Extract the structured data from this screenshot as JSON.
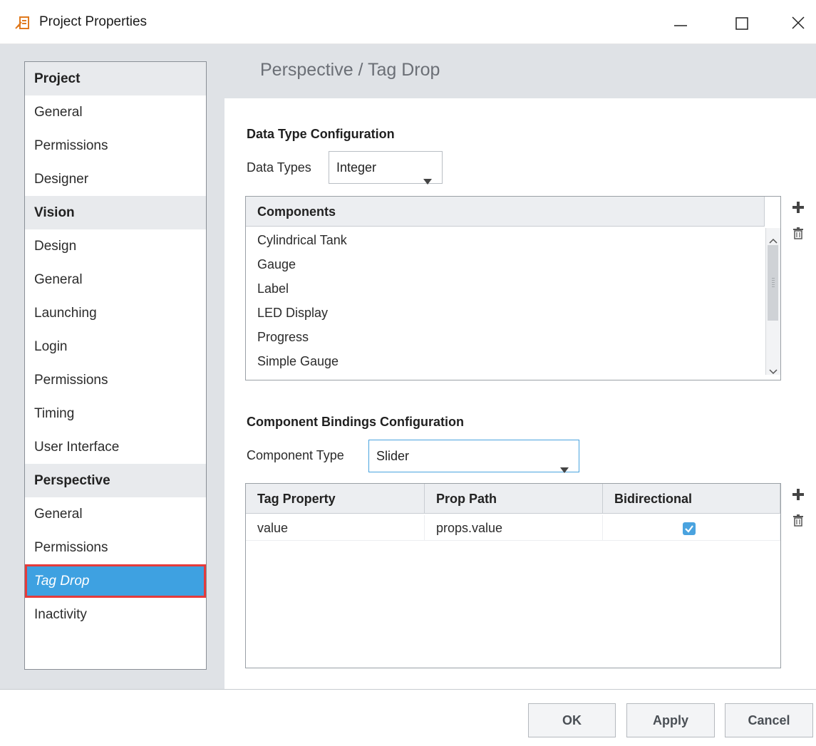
{
  "window": {
    "title": "Project Properties",
    "icons": {
      "app": "project-properties-icon",
      "minimize": "minimize-icon",
      "maximize": "maximize-icon",
      "close": "close-icon"
    }
  },
  "sidebar": {
    "items": [
      {
        "label": "Project",
        "type": "header"
      },
      {
        "label": "General",
        "type": "item"
      },
      {
        "label": "Permissions",
        "type": "item"
      },
      {
        "label": "Designer",
        "type": "item"
      },
      {
        "label": "Vision",
        "type": "header"
      },
      {
        "label": "Design",
        "type": "item"
      },
      {
        "label": "General",
        "type": "item"
      },
      {
        "label": "Launching",
        "type": "item"
      },
      {
        "label": "Login",
        "type": "item"
      },
      {
        "label": "Permissions",
        "type": "item"
      },
      {
        "label": "Timing",
        "type": "item"
      },
      {
        "label": "User Interface",
        "type": "item"
      },
      {
        "label": "Perspective",
        "type": "header"
      },
      {
        "label": "General",
        "type": "item"
      },
      {
        "label": "Permissions",
        "type": "item"
      },
      {
        "label": "Tag Drop",
        "type": "item",
        "selected": true
      },
      {
        "label": "Inactivity",
        "type": "item"
      }
    ]
  },
  "content": {
    "title": "Perspective / Tag Drop",
    "data_type_section": {
      "heading": "Data Type Configuration",
      "data_types_label": "Data Types",
      "data_types_value": "Integer",
      "components_header": "Components",
      "components": [
        "Cylindrical Tank",
        "Gauge",
        "Label",
        "LED Display",
        "Progress",
        "Simple Gauge"
      ]
    },
    "bindings_section": {
      "heading": "Component Bindings Configuration",
      "component_type_label": "Component Type",
      "component_type_value": "Slider",
      "columns": [
        "Tag Property",
        "Prop Path",
        "Bidirectional"
      ],
      "rows": [
        {
          "tag_property": "value",
          "prop_path": "props.value",
          "bidirectional": true
        }
      ]
    },
    "icons": {
      "add": "plus-icon",
      "delete": "trash-icon"
    }
  },
  "footer": {
    "ok_label": "OK",
    "apply_label": "Apply",
    "cancel_label": "Cancel"
  },
  "colors": {
    "accent": "#3ea1e1",
    "selection_outline": "#e53b3b",
    "panel_bg": "#dfe2e6"
  }
}
